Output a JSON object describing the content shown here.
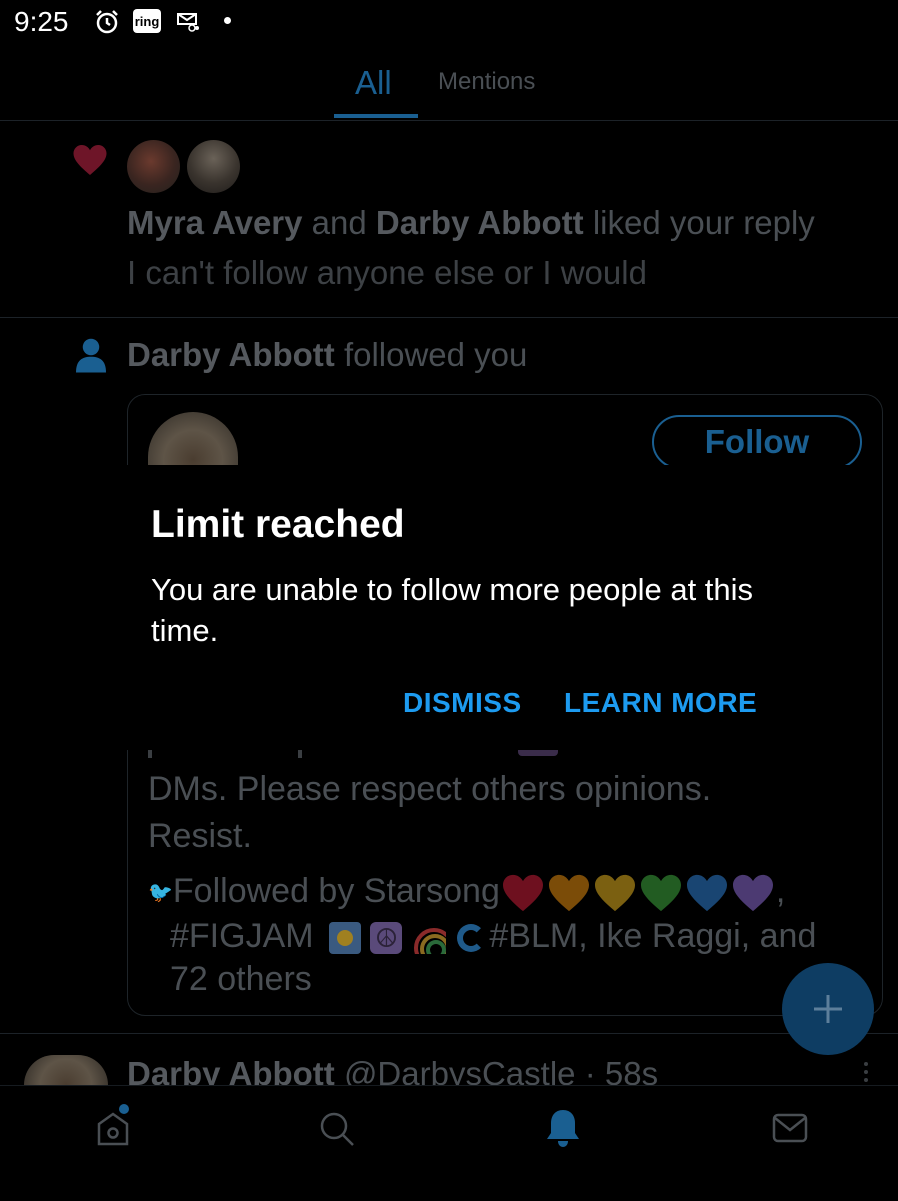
{
  "status_bar": {
    "time": "9:25",
    "icons": [
      "alarm-icon",
      "ring-app-icon",
      "rover-icon",
      "dot-indicator"
    ],
    "ring_label": "ring"
  },
  "tabs": [
    {
      "label": "All",
      "selected": true
    },
    {
      "label": "Mentions",
      "selected": false
    }
  ],
  "notifications": [
    {
      "type": "like",
      "icon": "heart-icon",
      "users": [
        "Myra Avery",
        "Darby Abbott"
      ],
      "conjunction": "and",
      "action": "liked your reply",
      "snippet": "I can't follow anyone else or I would"
    },
    {
      "type": "follow",
      "icon": "person-icon",
      "user": "Darby Abbott",
      "action": "followed you",
      "follow_button": "Follow",
      "bio_lines": [
        "DMs. Please respect others opinions.",
        "Resist."
      ],
      "followed_by_prefix": "Followed by Starsong",
      "followed_by_line2": "#FIGJAM",
      "followed_by_line2_rest": "#BLM, Ike Raggi, and",
      "followed_by_line3": "72 others",
      "heart_colors": [
        "#c81e3a",
        "#e08a10",
        "#e0b020",
        "#3fa83f",
        "#2f7fd0",
        "#8a6ad0"
      ]
    },
    {
      "type": "tweet",
      "name": "Darby Abbott",
      "handle": "@DarbysCastle",
      "separator": "·",
      "time": "58s"
    }
  ],
  "dialog": {
    "title": "Limit reached",
    "body": "You are unable to follow more people at this time.",
    "dismiss": "DISMISS",
    "learn_more": "LEARN MORE"
  },
  "fab": {
    "icon": "plus-icon"
  },
  "bottom_nav": [
    {
      "icon": "home-icon",
      "has_dot": true
    },
    {
      "icon": "search-icon"
    },
    {
      "icon": "bell-icon",
      "active": true
    },
    {
      "icon": "mail-icon"
    }
  ],
  "colors": {
    "accent": "#1d9bf0",
    "dim_accent": "#1a5f91"
  }
}
